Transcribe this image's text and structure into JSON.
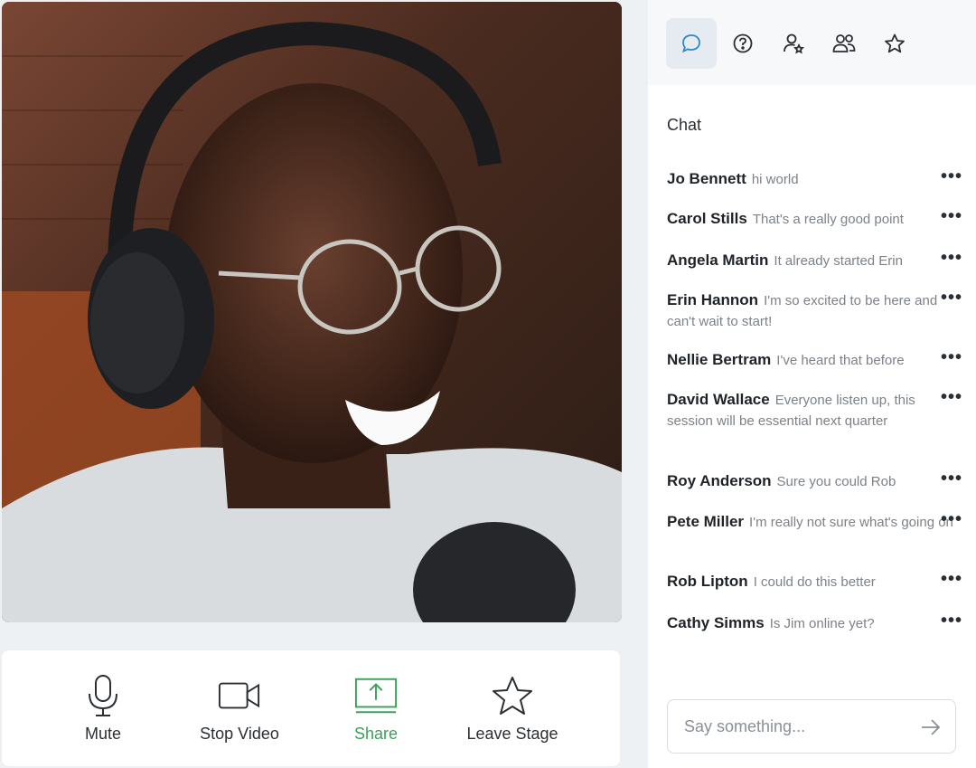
{
  "video": {
    "participant_image": "smiling-man-with-headphones-and-glasses"
  },
  "controls": {
    "mute_label": "Mute",
    "stop_video_label": "Stop Video",
    "share_label": "Share",
    "leave_stage_label": "Leave Stage",
    "active_color": "#3aa05a"
  },
  "sidebar": {
    "tabs": [
      {
        "icon": "chat-icon",
        "active": true
      },
      {
        "icon": "help-icon",
        "active": false
      },
      {
        "icon": "user-star-icon",
        "active": false
      },
      {
        "icon": "users-icon",
        "active": false
      },
      {
        "icon": "star-icon",
        "active": false
      }
    ],
    "chat_title": "Chat",
    "messages": [
      {
        "name": "Jo Bennett",
        "text": "hi world"
      },
      {
        "name": "Carol Stills",
        "text": "That's a really good point"
      },
      {
        "name": "Angela Martin",
        "text": "It already started Erin"
      },
      {
        "name": "Erin Hannon",
        "text": "I'm so excited to be here and can't wait to start!"
      },
      {
        "name": "Nellie Bertram",
        "text": "I've heard that before"
      },
      {
        "name": "David Wallace",
        "text": "Everyone listen up, this session will be essential next quarter"
      },
      {
        "name": "Roy Anderson",
        "text": "Sure you could Rob"
      },
      {
        "name": "Pete Miller",
        "text": "I'm really not sure what's going on"
      },
      {
        "name": "Rob Lipton",
        "text": "I could do this better"
      },
      {
        "name": "Cathy Simms",
        "text": "Is Jim online yet?"
      }
    ],
    "more_label": "•••",
    "input": {
      "placeholder": "Say something..."
    }
  }
}
